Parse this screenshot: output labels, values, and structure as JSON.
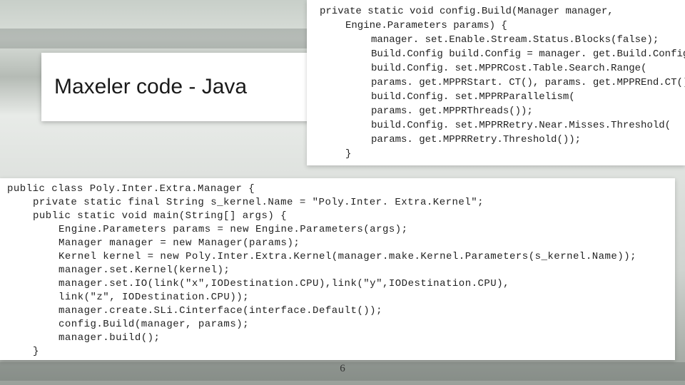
{
  "title": "Maxeler code - Java",
  "slide_number": "6",
  "code_top": [
    {
      "indent": 0,
      "text": "private static void config.Build(Manager manager,"
    },
    {
      "indent": 1,
      "text": "Engine.Parameters params) {"
    },
    {
      "indent": 2,
      "text": "manager. set.Enable.Stream.Status.Blocks(false);"
    },
    {
      "indent": 2,
      "text": "Build.Config build.Config = manager. get.Build.Config();"
    },
    {
      "indent": 2,
      "text": "build.Config. set.MPPRCost.Table.Search.Range("
    },
    {
      "indent": 2,
      "text": "params. get.MPPRStart. CT(), params. get.MPPREnd.CT());"
    },
    {
      "indent": 2,
      "text": "build.Config. set.MPPRParallelism("
    },
    {
      "indent": 2,
      "text": "params. get.MPPRThreads());"
    },
    {
      "indent": 2,
      "text": "build.Config. set.MPPRRetry.Near.Misses.Threshold("
    },
    {
      "indent": 2,
      "text": "params. get.MPPRRetry.Threshold());"
    },
    {
      "indent": 1,
      "text": "}"
    }
  ],
  "code_bottom": [
    {
      "indent": 0,
      "text": "public class Poly.Inter.Extra.Manager {"
    },
    {
      "indent": 1,
      "text": "private static final String s_kernel.Name = \"Poly.Inter. Extra.Kernel\";"
    },
    {
      "indent": 1,
      "text": "public static void main(String[] args) {"
    },
    {
      "indent": 2,
      "text": "Engine.Parameters params = new Engine.Parameters(args);"
    },
    {
      "indent": 2,
      "text": "Manager manager = new Manager(params);"
    },
    {
      "indent": 2,
      "text": "Kernel kernel = new Poly.Inter.Extra.Kernel(manager.make.Kernel.Parameters(s_kernel.Name));"
    },
    {
      "indent": 2,
      "text": "manager.set.Kernel(kernel);"
    },
    {
      "indent": 2,
      "text": "manager.set.IO(link(\"x\",IODestination.CPU),link(\"y\",IODestination.CPU),"
    },
    {
      "indent": 2,
      "text": "link(\"z\", IODestination.CPU));"
    },
    {
      "indent": 2,
      "text": "manager.create.SLi.Cinterface(interface.Default());"
    },
    {
      "indent": 2,
      "text": "config.Build(manager, params);"
    },
    {
      "indent": 2,
      "text": "manager.build();"
    },
    {
      "indent": 1,
      "text": "}"
    }
  ]
}
